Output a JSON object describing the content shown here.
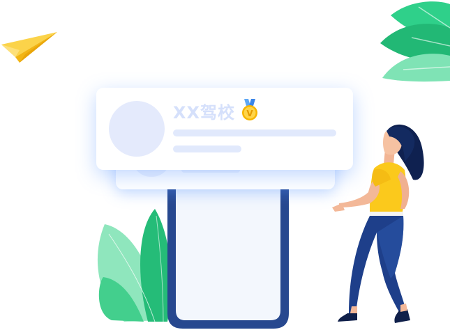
{
  "card": {
    "title": "XX驾校",
    "badge_letter": "V"
  },
  "icons": {
    "paper_plane": "paper-plane-icon",
    "medal": "medal-icon",
    "palm_leaves": "palm-leaves-icon",
    "plant": "plant-icon",
    "phone": "phone-icon",
    "person": "person-illustration"
  },
  "colors": {
    "title": "#d5e0fb",
    "placeholder": "#e1e9fc",
    "phone_frame": "#27488f",
    "phone_screen": "#f3f7fd",
    "leaf_green": "#27c383",
    "plane_yellow": "#fbc91c",
    "shirt_yellow": "#fbc91c",
    "jeans_blue": "#1e3f8a",
    "hair_navy": "#0f2150"
  }
}
